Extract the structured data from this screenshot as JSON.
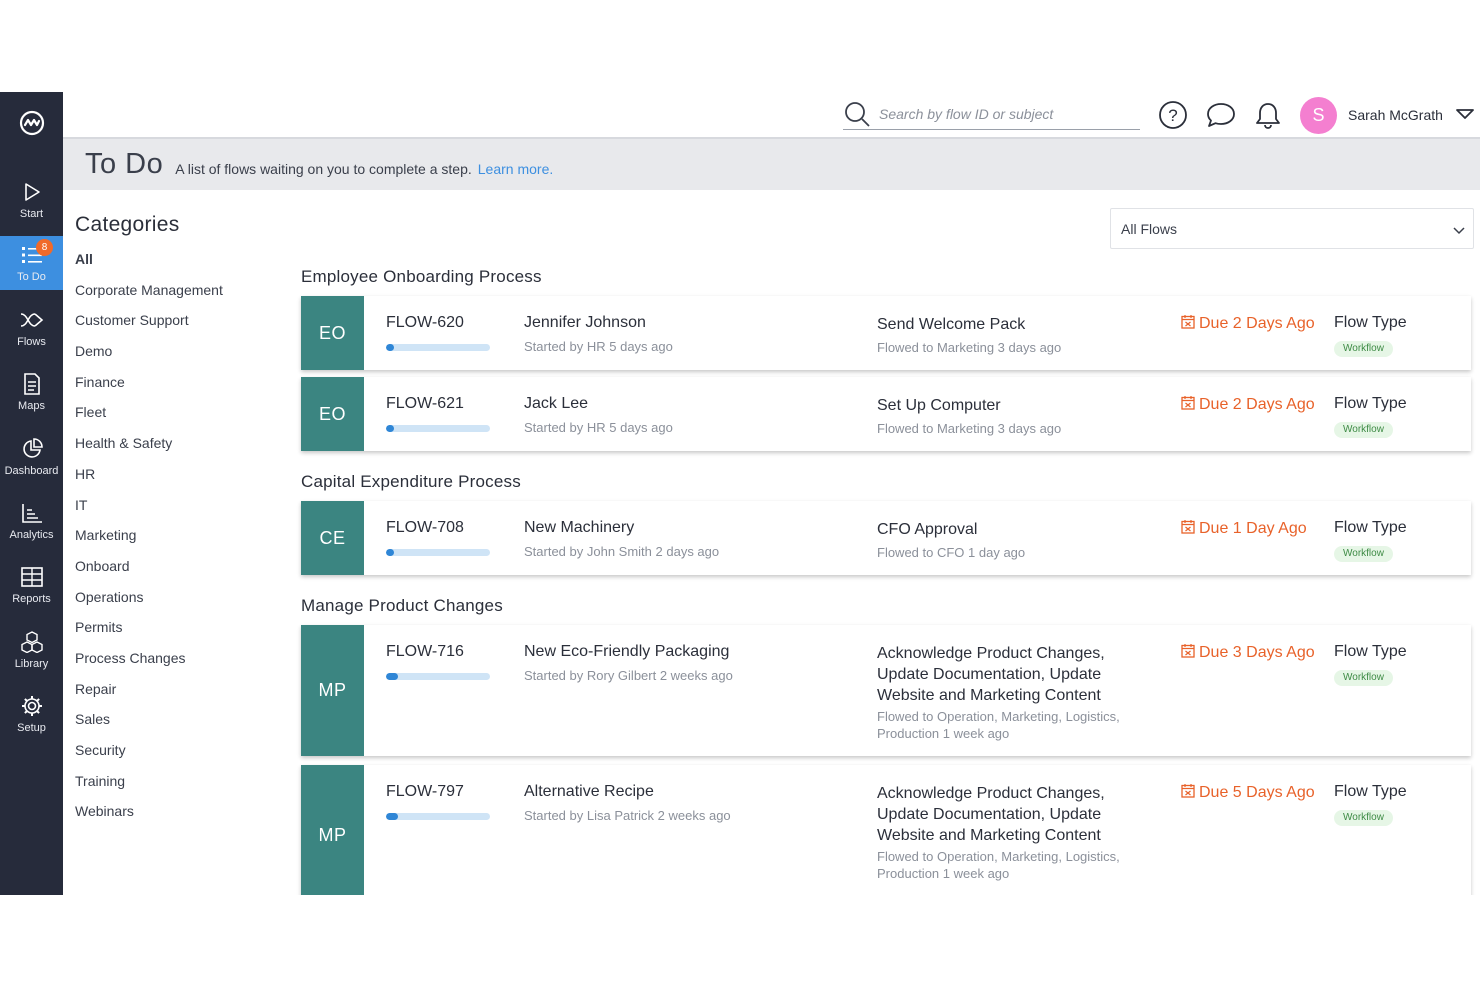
{
  "sidebar": {
    "items": [
      {
        "label": "Start",
        "icon": "play-icon"
      },
      {
        "label": "To Do",
        "icon": "list-icon",
        "badge": "8",
        "active": true
      },
      {
        "label": "Flows",
        "icon": "flows-icon"
      },
      {
        "label": "Maps",
        "icon": "document-icon"
      },
      {
        "label": "Dashboard",
        "icon": "pie-chart-icon"
      },
      {
        "label": "Analytics",
        "icon": "chart-icon"
      },
      {
        "label": "Reports",
        "icon": "table-icon"
      },
      {
        "label": "Library",
        "icon": "cubes-icon"
      },
      {
        "label": "Setup",
        "icon": "gear-icon"
      }
    ]
  },
  "topbar": {
    "search_placeholder": "Search by flow ID or subject",
    "avatar_initial": "S",
    "user_name": "Sarah McGrath"
  },
  "header": {
    "title": "To Do",
    "description": "A list of flows waiting on you to complete a step.",
    "learn_more": "Learn more."
  },
  "categories": {
    "title": "Categories",
    "items": [
      "All",
      "Corporate Management",
      "Customer Support",
      "Demo",
      "Finance",
      "Fleet",
      "Health & Safety",
      "HR",
      "IT",
      "Marketing",
      "Onboard",
      "Operations",
      "Permits",
      "Process Changes",
      "Repair",
      "Sales",
      "Security",
      "Training",
      "Webinars"
    ]
  },
  "filter": {
    "selected": "All Flows"
  },
  "colors": {
    "accent": "#3d8fe0",
    "sidebar": "#262b3b",
    "tile": "#3b8581",
    "due": "#e8622a",
    "badge": "#f06a2a",
    "avatar": "#f47fd0"
  },
  "groups": [
    {
      "title": "Employee Onboarding Process",
      "cards": [
        {
          "abbr": "EO",
          "id": "FLOW-620",
          "name": "Jennifer Johnson",
          "started": "Started by HR 5 days ago",
          "step": "Send Welcome Pack",
          "flowed": "Flowed to Marketing 3 days ago",
          "due": "Due 2 Days Ago",
          "type_label": "Flow Type",
          "type": "Workflow",
          "progress": 0.08
        },
        {
          "abbr": "EO",
          "id": "FLOW-621",
          "name": "Jack Lee",
          "started": "Started by HR 5 days ago",
          "step": "Set Up Computer",
          "flowed": "Flowed to Marketing 3 days ago",
          "due": "Due 2 Days Ago",
          "type_label": "Flow Type",
          "type": "Workflow",
          "progress": 0.08
        }
      ]
    },
    {
      "title": "Capital Expenditure Process",
      "cards": [
        {
          "abbr": "CE",
          "id": "FLOW-708",
          "name": "New Machinery",
          "started": "Started by John Smith 2 days ago",
          "step": "CFO Approval",
          "flowed": "Flowed to CFO 1 day ago",
          "due": "Due 1 Day Ago",
          "type_label": "Flow Type",
          "type": "Workflow",
          "progress": 0.08
        }
      ]
    },
    {
      "title": "Manage Product Changes",
      "cards": [
        {
          "abbr": "MP",
          "id": "FLOW-716",
          "name": "New Eco-Friendly Packaging",
          "started": "Started by Rory Gilbert 2 weeks ago",
          "step": "Acknowledge Product Changes, Update Documentation, Update Website and Marketing Content",
          "flowed": "Flowed to Operation, Marketing, Logistics, Production 1 week ago",
          "due": "Due 3 Days Ago",
          "type_label": "Flow Type",
          "type": "Workflow",
          "progress": 0.12
        },
        {
          "abbr": "MP",
          "id": "FLOW-797",
          "name": "Alternative Recipe",
          "started": "Started by Lisa Patrick 2 weeks ago",
          "step": "Acknowledge Product Changes, Update Documentation, Update Website and Marketing Content",
          "flowed": "Flowed to Operation, Marketing, Logistics, Production 1 week ago",
          "due": "Due 5 Days Ago",
          "type_label": "Flow Type",
          "type": "Workflow",
          "progress": 0.12
        }
      ]
    }
  ]
}
